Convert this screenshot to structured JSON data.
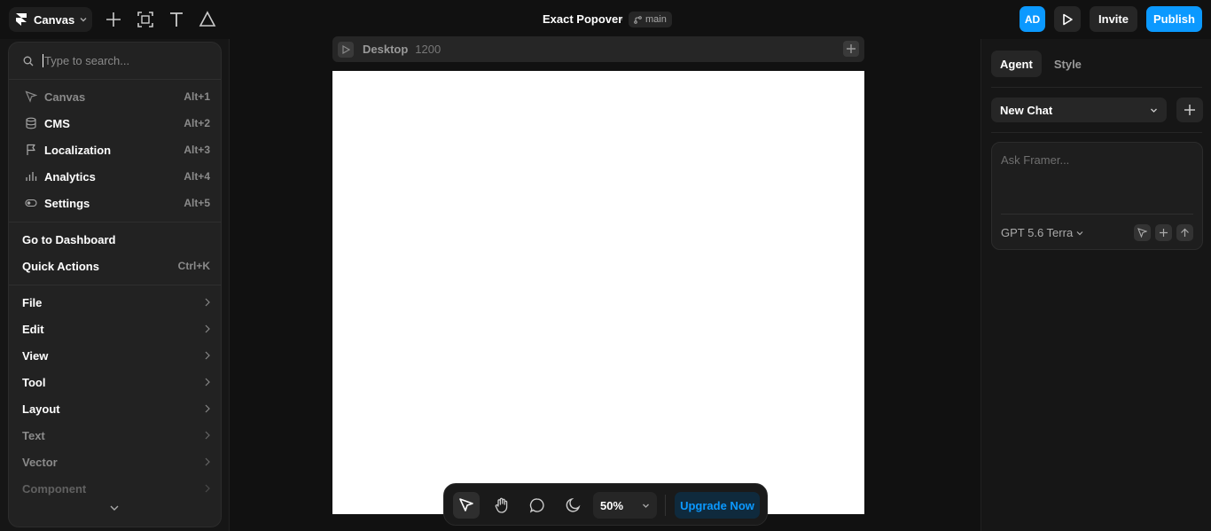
{
  "topbar": {
    "app_label": "Canvas",
    "doc_title": "Exact Popover",
    "separator": "·",
    "branch": "main",
    "avatar_initials": "AD",
    "invite_label": "Invite",
    "publish_label": "Publish"
  },
  "frame": {
    "name": "Desktop",
    "width": "1200"
  },
  "menu": {
    "search_placeholder": "Type to search...",
    "items": [
      {
        "label": "Canvas",
        "shortcut": "Alt+1",
        "icon": "cursor-icon"
      },
      {
        "label": "CMS",
        "shortcut": "Alt+2",
        "icon": "database-icon"
      },
      {
        "label": "Localization",
        "shortcut": "Alt+3",
        "icon": "flag-icon"
      },
      {
        "label": "Analytics",
        "shortcut": "Alt+4",
        "icon": "bar-chart-icon"
      },
      {
        "label": "Settings",
        "shortcut": "Alt+5",
        "icon": "toggle-icon"
      }
    ],
    "actions": [
      {
        "label": "Go to Dashboard",
        "shortcut": ""
      },
      {
        "label": "Quick Actions",
        "shortcut": "Ctrl+K"
      }
    ],
    "submenus": [
      "File",
      "Edit",
      "View",
      "Tool",
      "Layout",
      "Text",
      "Vector",
      "Component"
    ]
  },
  "toolbar": {
    "zoom": "50%",
    "upgrade_label": "Upgrade Now"
  },
  "right_panel": {
    "tabs": [
      "Agent",
      "Style"
    ],
    "chat_select": "New Chat",
    "ask_placeholder": "Ask Framer...",
    "model": "GPT 5.6 Terra"
  },
  "colors": {
    "accent": "#0b99ff",
    "background": "#111111",
    "panel": "#222222"
  }
}
